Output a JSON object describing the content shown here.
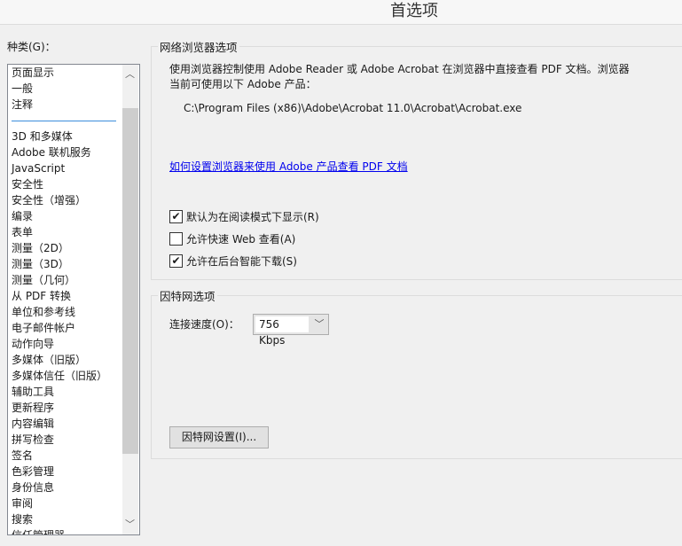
{
  "window": {
    "title": "首选项"
  },
  "categories": {
    "label": "种类(G)：",
    "items_top": [
      "页面显示",
      "一般",
      "注释"
    ],
    "items": [
      "3D 和多媒体",
      "Adobe 联机服务",
      "JavaScript",
      "安全性",
      "安全性（增强）",
      "编录",
      "表单",
      "测量（2D）",
      "测量（3D）",
      "测量（几何）",
      "从 PDF 转换",
      "单位和参考线",
      "电子邮件帐户",
      "动作向导",
      "多媒体（旧版）",
      "多媒体信任（旧版）",
      "辅助工具",
      "更新程序",
      "内容编辑",
      "拼写检查",
      "签名",
      "色彩管理",
      "身份信息",
      "审阅",
      "搜索",
      "信任管理器"
    ]
  },
  "browser": {
    "title": "网络浏览器选项",
    "desc1": "使用浏览器控制使用 Adobe Reader 或 Adobe Acrobat 在浏览器中直接查看 PDF 文档。浏览器",
    "desc2": "当前可使用以下 Adobe 产品：",
    "path": "C:\\Program Files (x86)\\Adobe\\Acrobat 11.0\\Acrobat\\Acrobat.exe",
    "link": "如何设置浏览器来使用 Adobe 产品查看 PDF 文档",
    "checkboxes": [
      {
        "label": "默认为在阅读模式下显示(R)",
        "checked": true
      },
      {
        "label": "允许快速 Web 查看(A)",
        "checked": false
      },
      {
        "label": "允许在后台智能下载(S)",
        "checked": true
      }
    ]
  },
  "internet": {
    "title": "因特网选项",
    "speed_label": "连接速度(O)：",
    "speed_value": "756 Kbps",
    "settings_button": "因特网设置(I)..."
  }
}
